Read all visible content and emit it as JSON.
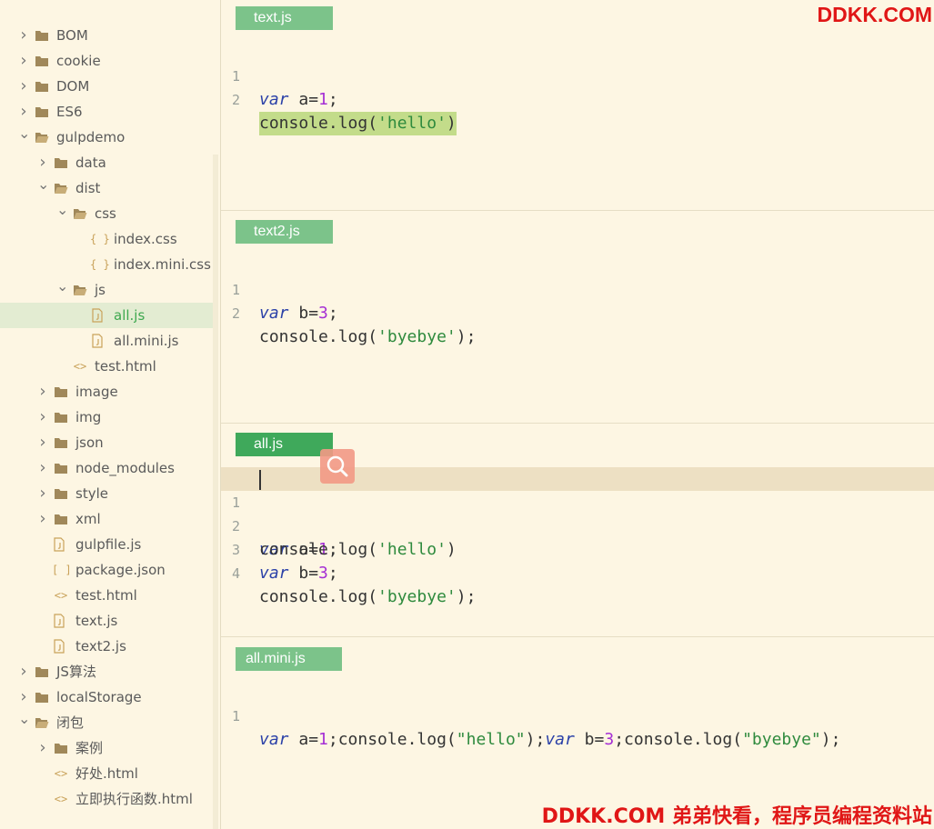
{
  "sidebar": {
    "items": [
      {
        "label": "BOM",
        "kind": "folder",
        "state": "collapsed"
      },
      {
        "label": "cookie",
        "kind": "folder",
        "state": "collapsed"
      },
      {
        "label": "DOM",
        "kind": "folder",
        "state": "collapsed"
      },
      {
        "label": "ES6",
        "kind": "folder",
        "state": "collapsed"
      },
      {
        "label": "gulpdemo",
        "kind": "folder",
        "state": "expanded"
      },
      {
        "label": "data",
        "kind": "folder",
        "state": "collapsed"
      },
      {
        "label": "dist",
        "kind": "folder",
        "state": "expanded"
      },
      {
        "label": "css",
        "kind": "folder",
        "state": "expanded"
      },
      {
        "label": "index.css",
        "kind": "css-file"
      },
      {
        "label": "index.mini.css",
        "kind": "css-file"
      },
      {
        "label": "js",
        "kind": "folder",
        "state": "expanded"
      },
      {
        "label": "all.js",
        "kind": "js-file",
        "selected": true
      },
      {
        "label": "all.mini.js",
        "kind": "js-file"
      },
      {
        "label": "test.html",
        "kind": "html-file"
      },
      {
        "label": "image",
        "kind": "folder",
        "state": "collapsed"
      },
      {
        "label": "img",
        "kind": "folder",
        "state": "collapsed"
      },
      {
        "label": "json",
        "kind": "folder",
        "state": "collapsed"
      },
      {
        "label": "node_modules",
        "kind": "folder",
        "state": "collapsed"
      },
      {
        "label": "style",
        "kind": "folder",
        "state": "collapsed"
      },
      {
        "label": "xml",
        "kind": "folder",
        "state": "collapsed"
      },
      {
        "label": "gulpfile.js",
        "kind": "js-file"
      },
      {
        "label": "package.json",
        "kind": "json-file"
      },
      {
        "label": "test.html",
        "kind": "html-file"
      },
      {
        "label": "text.js",
        "kind": "js-file"
      },
      {
        "label": "text2.js",
        "kind": "js-file"
      },
      {
        "label": "JS算法",
        "kind": "folder",
        "state": "collapsed"
      },
      {
        "label": "localStorage",
        "kind": "folder",
        "state": "collapsed"
      },
      {
        "label": "闭包",
        "kind": "folder",
        "state": "expanded"
      },
      {
        "label": "案例",
        "kind": "folder",
        "state": "collapsed"
      },
      {
        "label": "好处.html",
        "kind": "html-file"
      },
      {
        "label": "立即执行函数.html",
        "kind": "html-file"
      }
    ]
  },
  "panes": [
    {
      "tab": "text.js",
      "lines": [
        "var a=1;",
        "console.log('hello')"
      ]
    },
    {
      "tab": "text2.js",
      "lines": [
        "var b=3;",
        "console.log('byebye');"
      ]
    },
    {
      "tab": "all.js",
      "lines": [
        "var a=1;",
        "console.log('hello')",
        "var b=3;",
        "console.log('byebye');"
      ]
    },
    {
      "tab": "all.mini.js",
      "lines": [
        "var a=1;console.log(\"hello\");var b=3;console.log(\"byebye\");"
      ]
    }
  ],
  "line_numbers": [
    "1",
    "2",
    "3",
    "4"
  ],
  "watermark": {
    "top": "DDKK.COM",
    "bottom": "DDKK.COM 弟弟快看，程序员编程资料站"
  },
  "colors": {
    "accent": "#3fa95b",
    "tab": "#7cc38a",
    "keyword": "#2b41a8",
    "number": "#a52fd4",
    "string": "#2e8a3d",
    "watermark": "#e01616"
  }
}
